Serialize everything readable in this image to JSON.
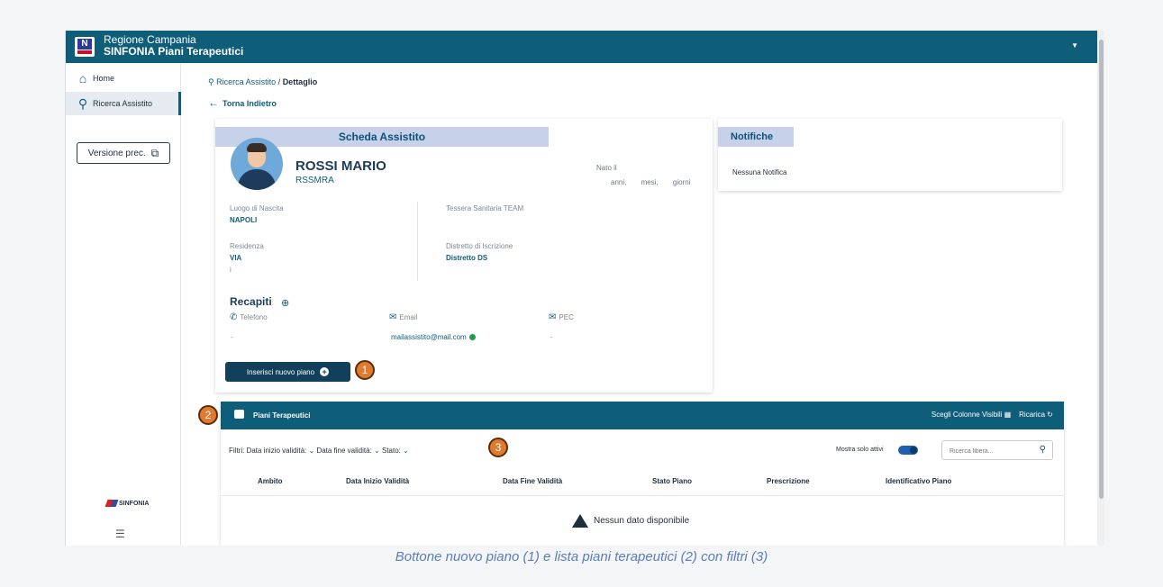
{
  "header": {
    "region": "Regione Campania",
    "app": "SINFONIA Piani Terapeutici"
  },
  "sidebar": {
    "items": [
      {
        "label": "Home"
      },
      {
        "label": "Ricerca Assistito"
      }
    ],
    "version_button": "Versione prec.",
    "brand": "SINFONIA"
  },
  "breadcrumb": {
    "link": "Ricerca Assistito",
    "separator": "/",
    "current": "Dettaglio"
  },
  "back_label": "Torna Indietro",
  "scheda": {
    "tab": "Scheda Assistito",
    "name": "ROSSI MARIO",
    "cf": "RSSMRA",
    "nato_label": "Nato il",
    "age_text": "anni, mesi, giorni",
    "luogo_label": "Luogo di Nascita",
    "luogo_value": "NAPOLI",
    "tessera_label": "Tessera Sanitaria TEAM",
    "residenza_label": "Residenza",
    "residenza_value": "VIA",
    "residenza_sub": "i",
    "distretto_label": "Distretto di Iscrizione",
    "distretto_value": "Distretto DS",
    "recapiti_title": "Recapiti",
    "telefono_label": "Telefono",
    "telefono_value": "-",
    "email_label": "Email",
    "email_value": "mailassistito@mail.com",
    "pec_label": "PEC",
    "pec_value": "-",
    "new_plan_button": "Inserisci nuovo piano"
  },
  "notifiche": {
    "tab": "Notifiche",
    "text": "Nessuna Notifica"
  },
  "piani": {
    "title": "Piani Terapeutici",
    "columns_button": "Scegli Colonne Visibili",
    "reload_button": "Ricarica",
    "filters_label": "Filtri:",
    "filter_1": "Data inizio validità:",
    "filter_2": "Data fine validità:",
    "filter_3": "Stato:",
    "toggle_label": "Mostra solo attivi",
    "search_placeholder": "Ricerca libera...",
    "columns": [
      "Ambito",
      "Data Inizio Validità",
      "Data Fine Validità",
      "Stato Piano",
      "Prescrizione",
      "Identificativo Piano"
    ],
    "empty_text": "Nessun dato disponibile"
  },
  "badges": [
    "1",
    "2",
    "3"
  ],
  "caption": "Bottone nuovo piano (1) e lista piani terapeutici (2) con filtri (3)",
  "colors": {
    "primary": "#0f5e79",
    "tab_bg": "#c6d2ea",
    "badge": "#e07a2e",
    "caption": "#5b7db8"
  }
}
